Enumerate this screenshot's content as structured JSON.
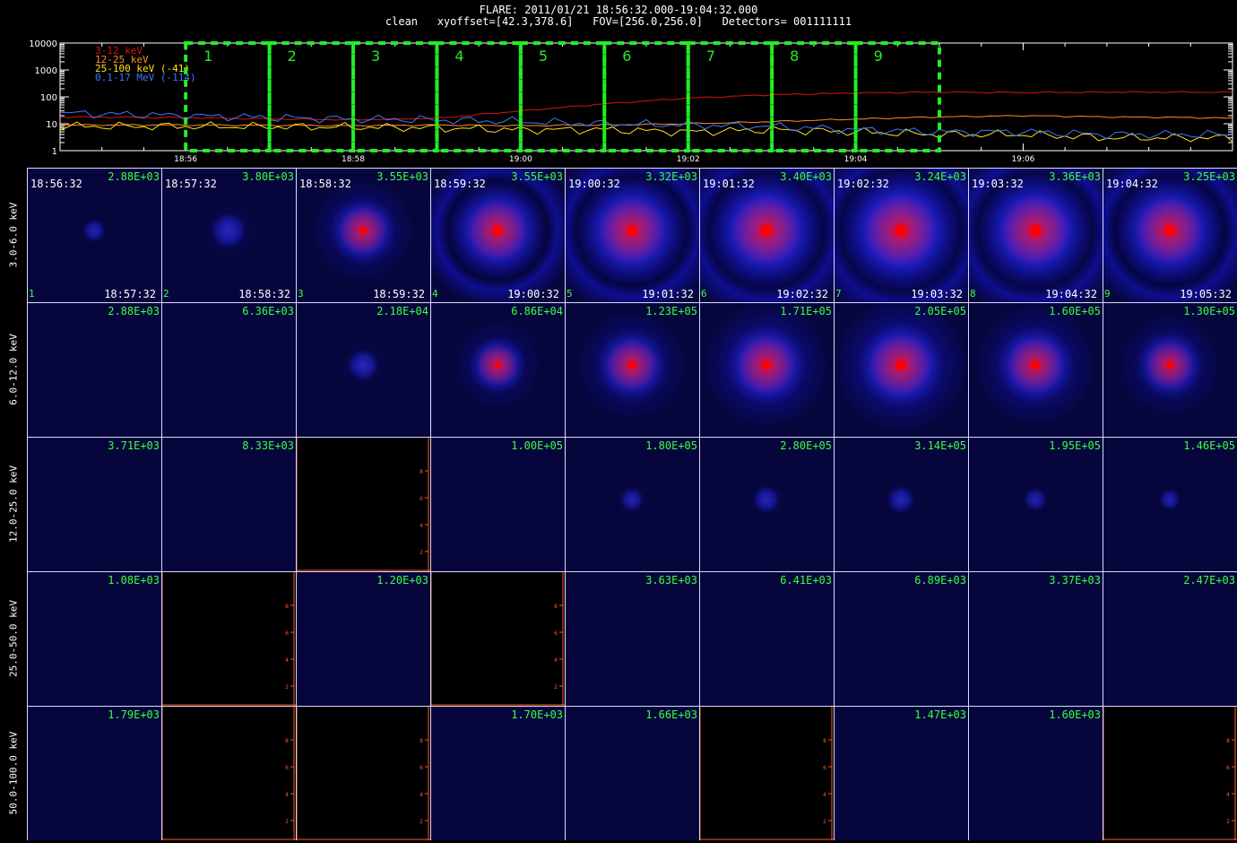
{
  "header": {
    "line1": "FLARE: 2011/01/21 18:56:32.000-19:04:32.000",
    "line2": "clean   xyoffset=[42.3,378.6]   FOV=[256.0,256.0]   Detectors= 001111111"
  },
  "chart_data": [
    {
      "type": "line",
      "x_ticks": [
        "18:56",
        "18:58",
        "19:00",
        "19:02",
        "19:04",
        "19:06"
      ],
      "y_ticks": [
        "1",
        "10",
        "100",
        "1000",
        "10000"
      ],
      "y_scale": "log",
      "ylim": [
        1,
        10000
      ],
      "x_minutes_range": [
        -1.5,
        12.5
      ],
      "intervals": [
        "1",
        "2",
        "3",
        "4",
        "5",
        "6",
        "7",
        "8",
        "9"
      ],
      "interval_color": "#22ee22",
      "legend_position": "top-left",
      "series": [
        {
          "name": "3-12 keV",
          "color": "#dd1111",
          "points": [
            [
              -1.5,
              18
            ],
            [
              0,
              17
            ],
            [
              1,
              15
            ],
            [
              2,
              14
            ],
            [
              3,
              16
            ],
            [
              4,
              30
            ],
            [
              5,
              55
            ],
            [
              6,
              90
            ],
            [
              7,
              120
            ],
            [
              8,
              140
            ],
            [
              9,
              150
            ],
            [
              10,
              145
            ],
            [
              11,
              150
            ],
            [
              12,
              150
            ],
            [
              13,
              145
            ],
            [
              14,
              140
            ],
            [
              15,
              140
            ],
            [
              16,
              135
            ],
            [
              17,
              130
            ],
            [
              18,
              135
            ]
          ]
        },
        {
          "name": "12-25 keV",
          "color": "#ff8c22",
          "points": [
            [
              -1.5,
              9
            ],
            [
              0,
              9
            ],
            [
              2,
              8.5
            ],
            [
              3,
              9
            ],
            [
              4,
              8.5
            ],
            [
              5,
              9
            ],
            [
              6,
              10
            ],
            [
              7,
              12
            ],
            [
              8,
              15
            ],
            [
              9,
              18
            ],
            [
              10,
              20
            ],
            [
              11,
              18
            ],
            [
              12,
              17
            ],
            [
              13,
              15
            ],
            [
              14,
              13
            ],
            [
              15,
              12
            ],
            [
              16,
              11
            ],
            [
              17,
              10
            ],
            [
              18,
              10
            ]
          ]
        },
        {
          "name": "25-100 keV (-41)",
          "color": "#ffe01a",
          "points": [
            [
              -1.5,
              8
            ],
            [
              0,
              8
            ],
            [
              2,
              7.5
            ],
            [
              3,
              7
            ],
            [
              4,
              6
            ],
            [
              5,
              6
            ],
            [
              6,
              5
            ],
            [
              7,
              6
            ],
            [
              8,
              5
            ],
            [
              9,
              4
            ],
            [
              10,
              4
            ],
            [
              11,
              3
            ],
            [
              12,
              3
            ],
            [
              13,
              3
            ],
            [
              14,
              2.5
            ],
            [
              15,
              2.5
            ],
            [
              16,
              2.5
            ],
            [
              17,
              2
            ],
            [
              18,
              2
            ]
          ]
        },
        {
          "name": "0.1-17 MeV (-114)",
          "color": "#3a79ff",
          "points": [
            [
              -1.5,
              25
            ],
            [
              0,
              20
            ],
            [
              1,
              17
            ],
            [
              2,
              15
            ],
            [
              3,
              14
            ],
            [
              4,
              12
            ],
            [
              5,
              10
            ],
            [
              6,
              9
            ],
            [
              7,
              8
            ],
            [
              8,
              6
            ],
            [
              9,
              5
            ],
            [
              10,
              5
            ],
            [
              11,
              4
            ],
            [
              12,
              4
            ],
            [
              13,
              4
            ],
            [
              14,
              3.5
            ],
            [
              15,
              3
            ],
            [
              16,
              3
            ],
            [
              17,
              2.5
            ],
            [
              18,
              2.5
            ]
          ]
        }
      ]
    },
    {
      "type": "heatmap",
      "rows": [
        "3.0-6.0 keV",
        "6.0-12.0 keV",
        "12.0-25.0 keV",
        "25.0-50.0 keV",
        "50.0-100.0 keV"
      ],
      "cols": [
        "1",
        "2",
        "3",
        "4",
        "5",
        "6",
        "7",
        "8",
        "9"
      ],
      "start_times": [
        "18:56:32",
        "18:57:32",
        "18:58:32",
        "18:59:32",
        "19:00:32",
        "19:01:32",
        "19:02:32",
        "19:03:32",
        "19:04:32"
      ],
      "end_times": [
        "18:57:32",
        "18:58:32",
        "18:59:32",
        "19:00:32",
        "19:01:32",
        "19:02:32",
        "19:03:32",
        "19:04:32",
        "19:05:32"
      ],
      "max_values": [
        [
          "2.88E+03",
          "3.80E+03",
          "3.55E+03",
          "3.55E+03",
          "3.32E+03",
          "3.40E+03",
          "3.24E+03",
          "3.36E+03",
          "3.25E+03"
        ],
        [
          "2.88E+03",
          "6.36E+03",
          "2.18E+04",
          "6.86E+04",
          "1.23E+05",
          "1.71E+05",
          "2.05E+05",
          "1.60E+05",
          "1.30E+05"
        ],
        [
          "3.71E+03",
          "8.33E+03",
          "",
          "1.00E+05",
          "1.80E+05",
          "2.80E+05",
          "3.14E+05",
          "1.95E+05",
          "1.46E+05"
        ],
        [
          "1.08E+03",
          "",
          "1.20E+03",
          "",
          "3.63E+03",
          "6.41E+03",
          "6.89E+03",
          "3.37E+03",
          "2.47E+03"
        ],
        [
          "1.79E+03",
          "",
          "",
          "1.70E+03",
          "1.66E+03",
          "",
          "1.47E+03",
          "1.60E+03",
          ""
        ]
      ],
      "empty_cells": [
        [
          2,
          2
        ],
        [
          3,
          1
        ],
        [
          3,
          3
        ],
        [
          4,
          1
        ],
        [
          4,
          2
        ],
        [
          4,
          5
        ],
        [
          4,
          8
        ]
      ],
      "source_intensity": [
        [
          0.05,
          0.2,
          0.55,
          0.75,
          0.85,
          0.9,
          0.95,
          0.9,
          0.85
        ],
        [
          0,
          0,
          0.15,
          0.45,
          0.6,
          0.72,
          0.78,
          0.68,
          0.55
        ],
        [
          0,
          0,
          0,
          0,
          0.06,
          0.1,
          0.1,
          0.05,
          0.03
        ],
        [
          0,
          0,
          0,
          0,
          0,
          0,
          0,
          0,
          0
        ],
        [
          0,
          0,
          0,
          0,
          0,
          0,
          0,
          0,
          0
        ]
      ],
      "placeholder_ticks": [
        "2",
        "4",
        "6",
        "8"
      ],
      "colors": {
        "background": "#06063d",
        "source": "#2020ff",
        "core": "#ff0000",
        "label": "#3cff3c",
        "axis": "#ff5a1a"
      }
    }
  ]
}
